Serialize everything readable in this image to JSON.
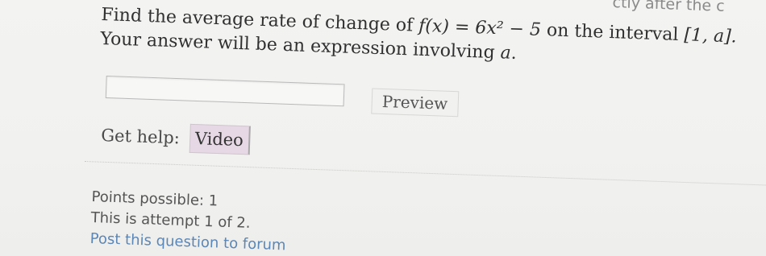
{
  "header_fragment": "ctly after the c",
  "question": {
    "line1_prefix": "Find the average rate of change of",
    "fx": "f(x) = 6x² − 5",
    "line1_mid": "on the interval",
    "interval": "[1, a].",
    "line2_prefix": "Your answer will be an expression involving",
    "variable": "a",
    "line2_suffix": "."
  },
  "answer": {
    "value": "",
    "placeholder": ""
  },
  "preview_label": "Preview",
  "help": {
    "label": "Get help:",
    "video_label": "Video"
  },
  "info": {
    "points": "Points possible: 1",
    "attempt": "This is attempt 1 of 2.",
    "forum_link": "Post this question to forum"
  }
}
